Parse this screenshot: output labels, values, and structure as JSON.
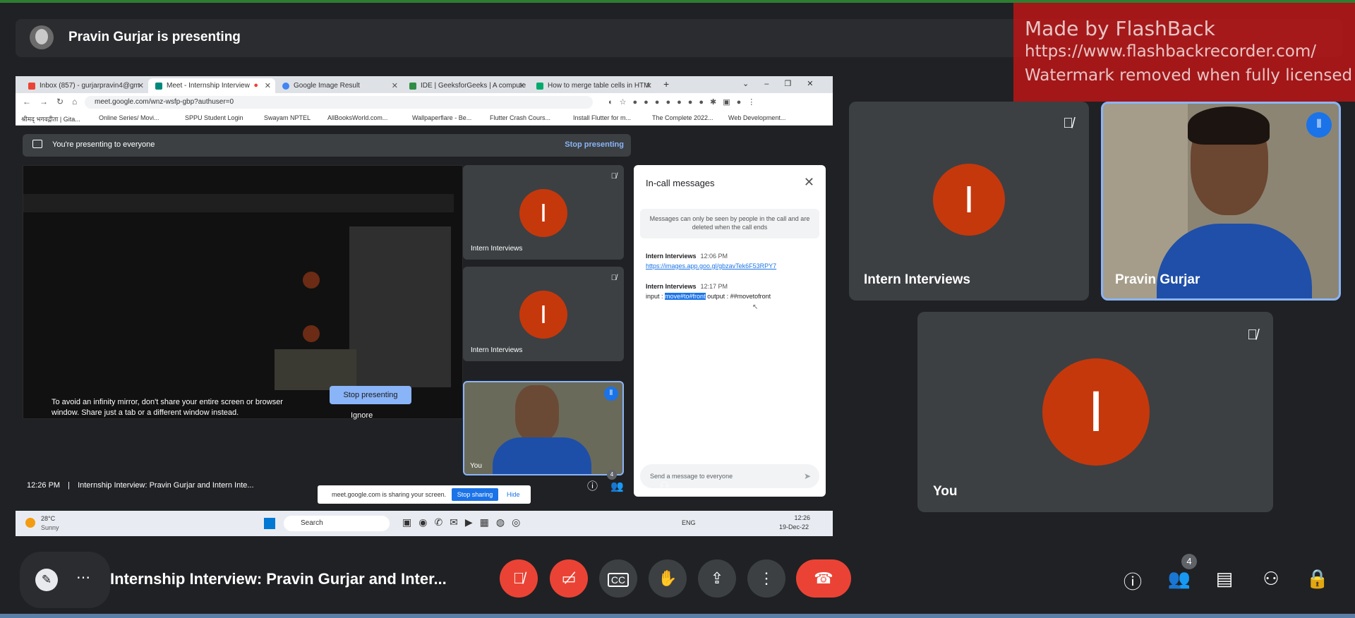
{
  "presenter_bar": {
    "name": "Pravin Gurjar is presenting"
  },
  "watermark": {
    "line1": "Made by FlashBack",
    "line2": "https://www.flashbackrecorder.com/",
    "line3": "Watermark removed when fully licensed"
  },
  "shared_screen": {
    "tabs": [
      {
        "label": "Inbox (857) - gurjarpravin4@gm",
        "icon_color": "#ea4335"
      },
      {
        "label": "Meet - Internship Interview",
        "icon_color": "#00897b"
      },
      {
        "label": "Google Image Result",
        "icon_color": "#4285f4"
      },
      {
        "label": "IDE | GeeksforGeeks | A compute",
        "icon_color": "#2f8d46"
      },
      {
        "label": "How to merge table cells in HTM",
        "icon_color": "#04aa6d"
      }
    ],
    "url": "meet.google.com/wnz-wsfp-gbp?authuser=0",
    "bookmarks": [
      "श्रीमद् भगवद्गीता | Gita...",
      "Online Series/ Movi...",
      "SPPU Student Login",
      "Swayam NPTEL",
      "AllBooksWorld.com...",
      "Wallpaperflare - Be...",
      "Flutter Crash Cours...",
      "Install Flutter for m...",
      "The Complete 2022...",
      "Web Development..."
    ],
    "banner_text": "You're presenting to everyone",
    "banner_stop": "Stop presenting",
    "mirror_message": "To avoid an infinity mirror, don't share your entire screen or browser window. Share just a tab or a different window instead.",
    "mirror_stop": "Stop presenting",
    "mirror_ignore": "Ignore",
    "tiles": [
      {
        "initial": "I",
        "name": "Intern Interviews"
      },
      {
        "initial": "I",
        "name": "Intern Interviews"
      }
    ],
    "you_tile": {
      "name": "You"
    },
    "chat": {
      "title": "In-call messages",
      "note": "Messages can only be seen by people in the call and are deleted when the call ends",
      "messages": [
        {
          "sender": "Intern Interviews",
          "time": "12:06 PM",
          "link": "https://images.app.goo.gl/gbzavTek6F53RPY7"
        },
        {
          "sender": "Intern Interviews",
          "time": "12:17 PM",
          "prefix": "input : ",
          "highlight": "move#to#front",
          "suffix": " output : ##movetofront"
        }
      ],
      "input_placeholder": "Send a message to everyone"
    },
    "meet_bottom": {
      "time": "12:26 PM",
      "separator": "|",
      "title": "Internship Interview: Pravin Gurjar and Intern Inte...",
      "participants_count": "4"
    },
    "sharing_bar": {
      "text": "meet.google.com is sharing your screen.",
      "stop": "Stop sharing",
      "hide": "Hide"
    },
    "taskbar": {
      "weather_temp": "28°C",
      "weather_desc": "Sunny",
      "search": "Search",
      "lang": "ENG",
      "time": "12:26",
      "date": "19-Dec-22"
    }
  },
  "tiles": [
    {
      "initial": "I",
      "name": "Intern Interviews",
      "muted": true
    },
    {
      "name": "Pravin Gurjar",
      "speaking": true
    },
    {
      "initial": "I",
      "name": "You",
      "muted": true
    }
  ],
  "controls": {
    "meeting_title": "Internship Interview: Pravin Gurjar and Inter...",
    "participants_count": "4",
    "end_call_color": "#ea4335",
    "accent": "#8ab4f8"
  }
}
